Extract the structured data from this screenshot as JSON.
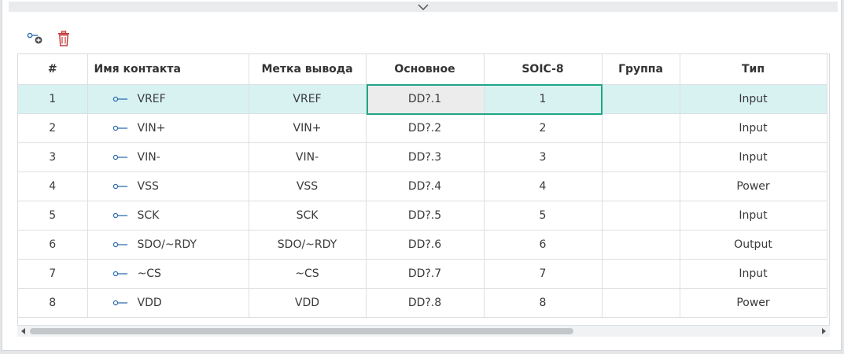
{
  "toolbar": {
    "add_icon": "add-pin-icon",
    "delete_icon": "trash-icon"
  },
  "colors": {
    "accent": "#1fa687",
    "selected_row": "#d8f2f2",
    "delete": "#c53838"
  },
  "table": {
    "headers": [
      "#",
      "Имя контакта",
      "Метка вывода",
      "Основное",
      "SOIC-8",
      "Группа",
      "Тип"
    ],
    "rows": [
      {
        "num": "1",
        "name": "VREF",
        "label": "VREF",
        "main": "DD?.1",
        "soic": "1",
        "group": "",
        "type": "Input"
      },
      {
        "num": "2",
        "name": "VIN+",
        "label": "VIN+",
        "main": "DD?.2",
        "soic": "2",
        "group": "",
        "type": "Input"
      },
      {
        "num": "3",
        "name": "VIN-",
        "label": "VIN-",
        "main": "DD?.3",
        "soic": "3",
        "group": "",
        "type": "Input"
      },
      {
        "num": "4",
        "name": "VSS",
        "label": "VSS",
        "main": "DD?.4",
        "soic": "4",
        "group": "",
        "type": "Power"
      },
      {
        "num": "5",
        "name": "SCK",
        "label": "SCK",
        "main": "DD?.5",
        "soic": "5",
        "group": "",
        "type": "Input"
      },
      {
        "num": "6",
        "name": "SDO/~RDY",
        "label": "SDO/~RDY",
        "main": "DD?.6",
        "soic": "6",
        "group": "",
        "type": "Output"
      },
      {
        "num": "7",
        "name": "~CS",
        "label": "~CS",
        "main": "DD?.7",
        "soic": "7",
        "group": "",
        "type": "Input"
      },
      {
        "num": "8",
        "name": "VDD",
        "label": "VDD",
        "main": "DD?.8",
        "soic": "8",
        "group": "",
        "type": "Power"
      }
    ]
  },
  "scrollbar": {
    "visible_fraction": 0.69
  }
}
